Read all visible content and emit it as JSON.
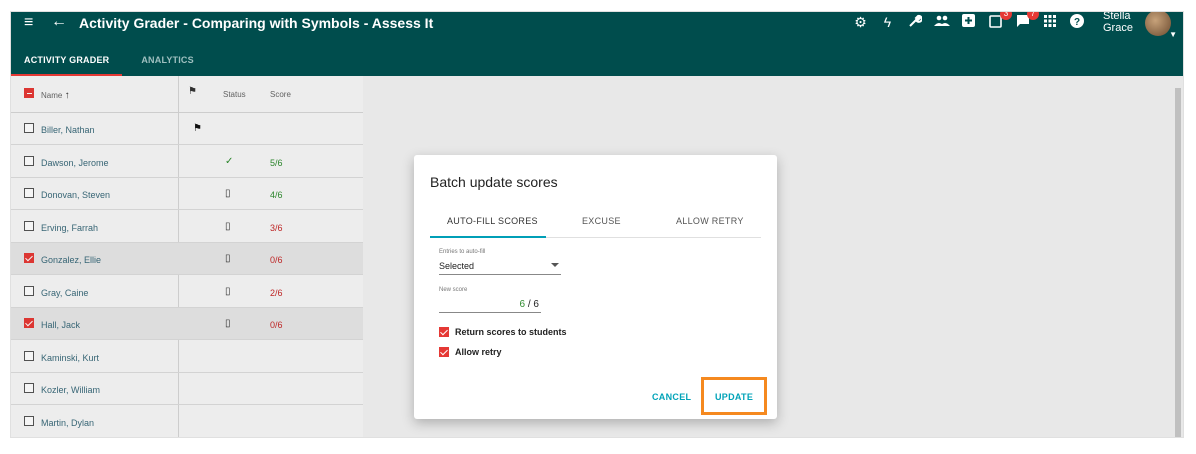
{
  "app": {
    "title": "Activity Grader - Comparing with Symbols - Assess It",
    "user": {
      "first": "Stella",
      "last": "Grace"
    },
    "badges": {
      "assignments": "3",
      "messages": "7"
    },
    "tabs": [
      "ACTIVITY GRADER",
      "ANALYTICS"
    ],
    "colors": {
      "header": "#004d4d",
      "accent": "#e53935",
      "link": "#00a3b8",
      "highlight": "#f5891f"
    }
  },
  "toolbar_icons": [
    "gear-icon",
    "bolt-icon",
    "wrench-icon",
    "people-icon",
    "add-box-icon",
    "assignment-icon",
    "messages-icon",
    "apps-grid-icon",
    "help-icon"
  ],
  "table": {
    "headers": {
      "name": "Name",
      "sort": "↑",
      "status": "Status",
      "score": "Score"
    },
    "rows": [
      {
        "name": "Biller, Nathan",
        "flag": "⚑",
        "status": "",
        "score": "",
        "checked": false,
        "score_color": ""
      },
      {
        "name": "Dawson, Jerome",
        "flag": "",
        "status": "✓",
        "score": "5/6",
        "checked": false,
        "score_color": "#2e8b2e"
      },
      {
        "name": "Donovan, Steven",
        "flag": "",
        "status": "▯",
        "score": "4/6",
        "checked": false,
        "score_color": "#2e8b2e"
      },
      {
        "name": "Erving, Farrah",
        "flag": "",
        "status": "▯",
        "score": "3/6",
        "checked": false,
        "score_color": "#c62828"
      },
      {
        "name": "Gonzalez, Ellie",
        "flag": "",
        "status": "▯",
        "score": "0/6",
        "checked": true,
        "score_color": "#c62828"
      },
      {
        "name": "Gray, Caine",
        "flag": "",
        "status": "▯",
        "score": "2/6",
        "checked": false,
        "score_color": "#c62828"
      },
      {
        "name": "Hall, Jack",
        "flag": "",
        "status": "▯",
        "score": "0/6",
        "checked": true,
        "score_color": "#c62828"
      },
      {
        "name": "Kaminski, Kurt",
        "flag": "",
        "status": "",
        "score": "",
        "checked": false,
        "score_color": ""
      },
      {
        "name": "Kozler, William",
        "flag": "",
        "status": "",
        "score": "",
        "checked": false,
        "score_color": ""
      },
      {
        "name": "Martin, Dylan",
        "flag": "",
        "status": "",
        "score": "",
        "checked": false,
        "score_color": ""
      }
    ]
  },
  "dialog": {
    "title": "Batch update scores",
    "tabs": [
      "AUTO-FILL SCORES",
      "EXCUSE",
      "ALLOW RETRY"
    ],
    "entries_label": "Entries to auto-fill",
    "entries_value": "Selected",
    "new_score_label": "New score",
    "new_score_value": "6",
    "new_score_total": "/ 6",
    "return_scores": "Return scores to students",
    "allow_retry": "Allow retry",
    "cancel": "CANCEL",
    "update": "UPDATE"
  }
}
